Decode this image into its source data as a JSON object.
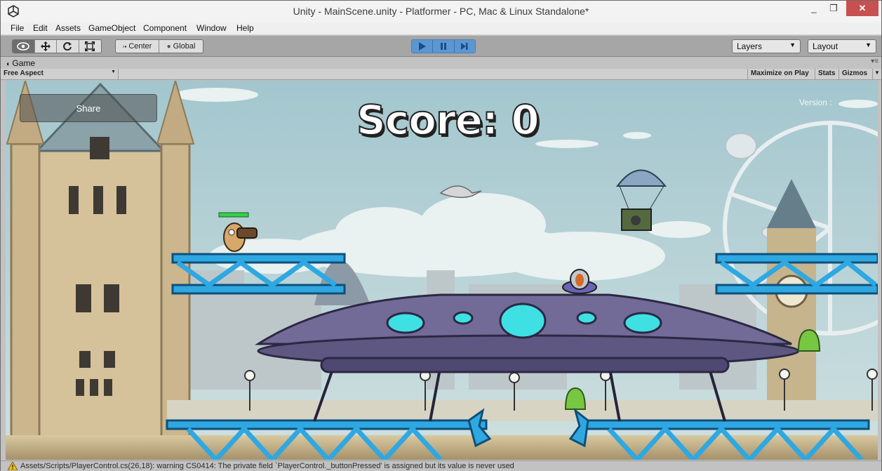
{
  "window": {
    "title": "Unity - MainScene.unity - Platformer - PC, Mac & Linux Standalone*",
    "minimize_glyph": "_",
    "maximize_glyph": "❐",
    "close_glyph": "✕"
  },
  "menu": [
    "File",
    "Edit",
    "Assets",
    "GameObject",
    "Component",
    "Window",
    "Help"
  ],
  "toolbar": {
    "tools": [
      "hand-view-icon",
      "move-icon",
      "rotate-icon",
      "scale-icon"
    ],
    "pivot_label": "Center",
    "space_label": "Global",
    "play_controls": [
      "play-icon",
      "pause-icon",
      "step-icon"
    ],
    "layers_label": "Layers",
    "layout_label": "Layout"
  },
  "game_tab": {
    "label": "Game",
    "aspect": "Free Aspect",
    "maximize_label": "Maximize on Play",
    "stats_label": "Stats",
    "gizmos_label": "Gizmos"
  },
  "game": {
    "share_label": "Share",
    "score_text": "Score: 0",
    "version_text": "Version :"
  },
  "status": {
    "message": "Assets/Scripts/PlayerControl.cs(26,18): warning CS0414: The private field `PlayerControl._buttonPressed' is assigned but its value is never used",
    "icon": "warning-icon"
  },
  "colors": {
    "sky": "#a9cbd2",
    "play_blue": "#5b97d3",
    "girder_blue": "#2fa8e2",
    "ufo_purple": "#6a6390",
    "ufo_window": "#3fe0e3"
  }
}
